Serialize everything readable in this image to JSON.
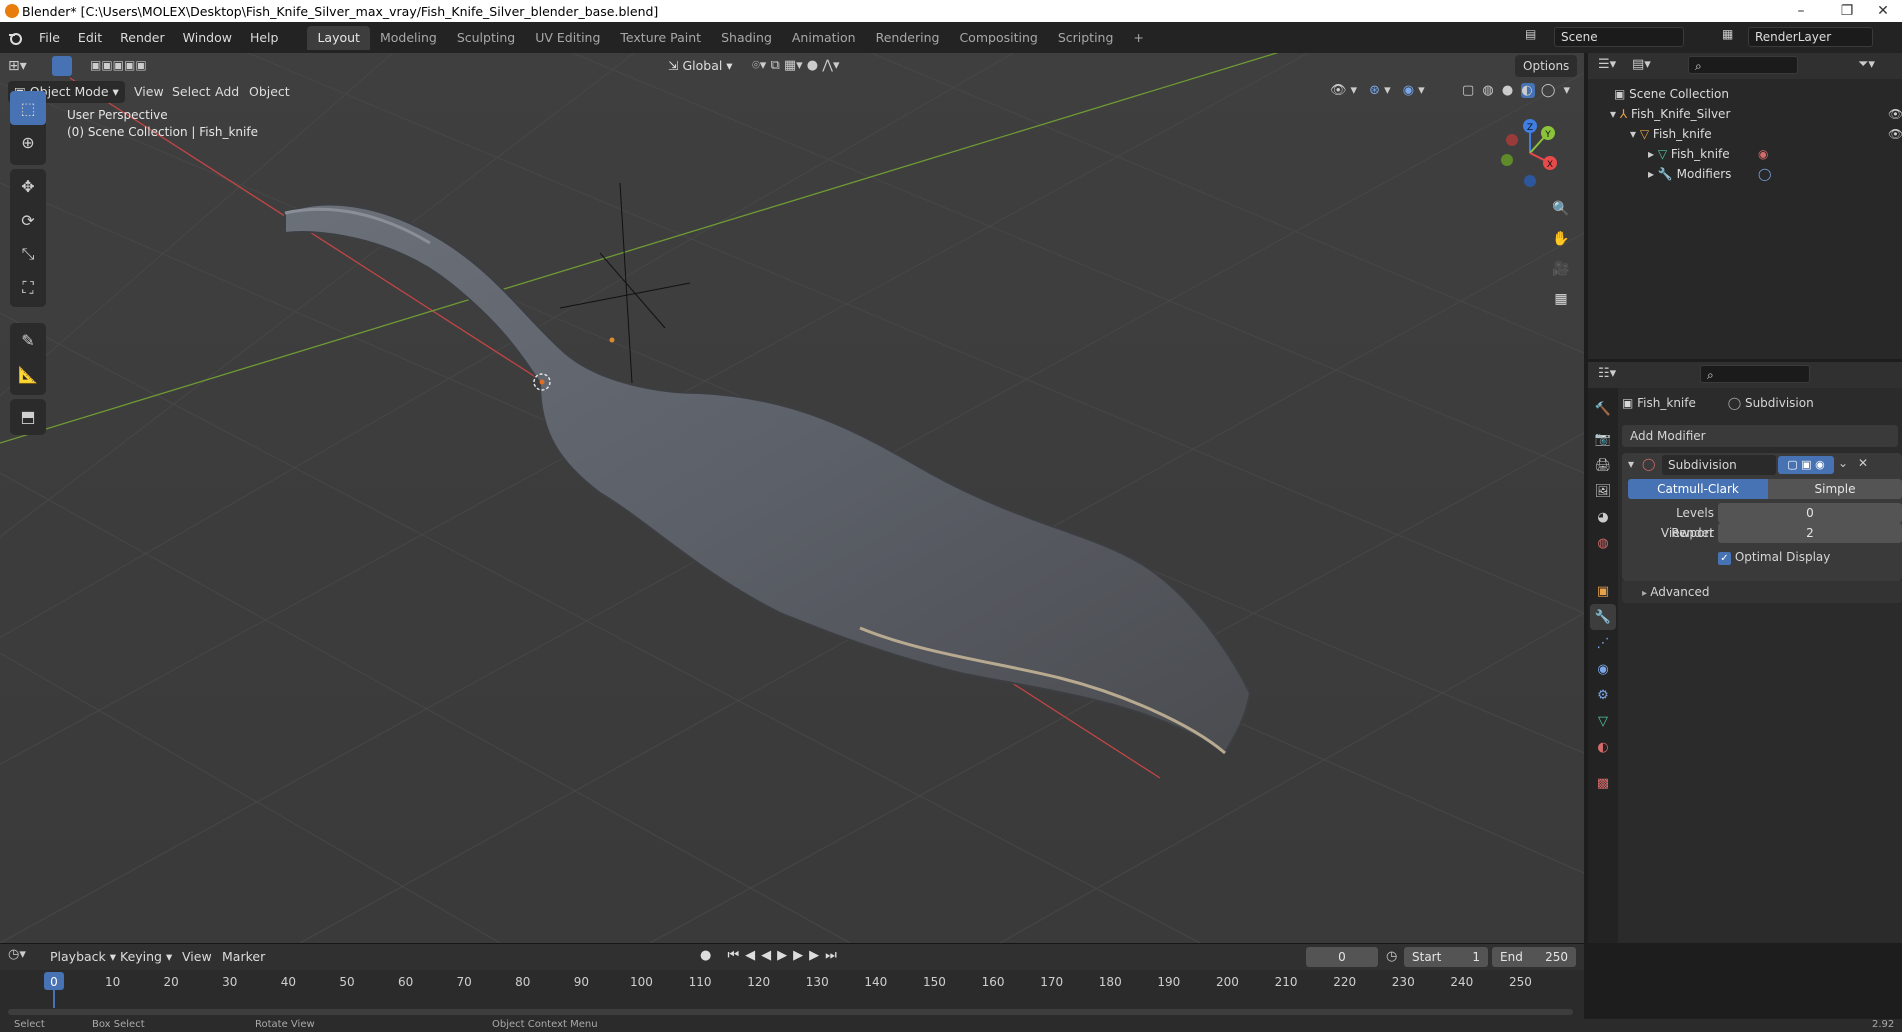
{
  "window": {
    "title": "Blender* [C:\\Users\\MOLEX\\Desktop\\Fish_Knife_Silver_max_vray/Fish_Knife_Silver_blender_base.blend]",
    "minimize": "–",
    "restore": "❐",
    "close": "✕"
  },
  "menu": [
    "File",
    "Edit",
    "Render",
    "Window",
    "Help"
  ],
  "workspaces": [
    "Layout",
    "Modeling",
    "Sculpting",
    "UV Editing",
    "Texture Paint",
    "Shading",
    "Animation",
    "Rendering",
    "Compositing",
    "Scripting"
  ],
  "workspace_add": "+",
  "scene": {
    "name": "Scene",
    "view_layer": "RenderLayer"
  },
  "viewport": {
    "mode": "Object Mode",
    "menus": [
      "View",
      "Select",
      "Add",
      "Object"
    ],
    "transform_orientation": "Global",
    "options": "Options",
    "overlay_text_1": "User Perspective",
    "overlay_text_2": "(0) Scene Collection | Fish_knife",
    "gizmo": {
      "x": "X",
      "y": "Y",
      "z": "Z"
    }
  },
  "timeline": {
    "menus": [
      "Playback",
      "Keying",
      "View",
      "Marker"
    ],
    "current_frame": "0",
    "start_label": "Start",
    "start": "1",
    "end_label": "End",
    "end": "250",
    "ticks": [
      "0",
      "10",
      "20",
      "30",
      "40",
      "50",
      "60",
      "70",
      "80",
      "90",
      "100",
      "110",
      "120",
      "130",
      "140",
      "150",
      "160",
      "170",
      "180",
      "190",
      "200",
      "210",
      "220",
      "230",
      "240",
      "250"
    ]
  },
  "statusbar": {
    "items": [
      "Select",
      "Box Select",
      "Rotate View",
      "Object Context Menu"
    ],
    "version": "2.92"
  },
  "outliner": {
    "root": "Scene Collection",
    "items": [
      {
        "label": "Fish_Knife_Silver",
        "level": 1
      },
      {
        "label": "Fish_knife",
        "level": 2
      },
      {
        "label": "Fish_knife",
        "level": 3
      },
      {
        "label": "Modifiers",
        "level": 3
      }
    ]
  },
  "properties": {
    "object_name": "Fish_knife",
    "modifier_breadcrumb": "Subdivision",
    "add_modifier": "Add Modifier",
    "modifier": {
      "name": "Subdivision",
      "type_options": [
        "Catmull-Clark",
        "Simple"
      ],
      "selected_type": "Catmull-Clark",
      "levels_viewport_label": "Levels Viewport",
      "levels_viewport": "0",
      "render_label": "Render",
      "render": "2",
      "optimal_display_label": "Optimal Display",
      "advanced_label": "Advanced"
    }
  },
  "colors": {
    "accent": "#4772b3",
    "x_axis": "#e84a4a",
    "y_axis": "#8bc43a",
    "z_axis": "#3f7fe3"
  }
}
